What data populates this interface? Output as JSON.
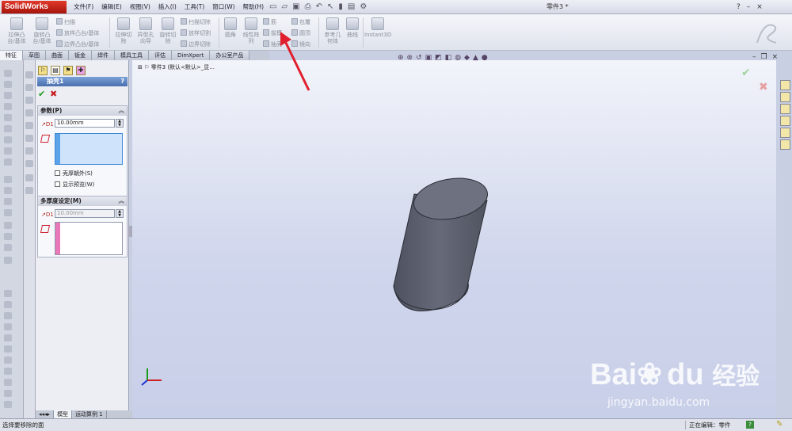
{
  "app": {
    "logo_text": "SolidWorks",
    "doc_title": "零件3 *"
  },
  "menu": [
    "文件(F)",
    "编辑(E)",
    "视图(V)",
    "插入(I)",
    "工具(T)",
    "窗口(W)",
    "帮助(H)"
  ],
  "window_controls": {
    "help": "?",
    "minimize": "–",
    "close": "×"
  },
  "ribbon": {
    "extrude_boss": "拉伸凸\n台/基体",
    "revolve_boss": "旋转凸\n台/基体",
    "sweep": "扫描",
    "loft": "放样凸台/基体",
    "boundary": "边界凸台/基体",
    "extrude_cut": "拉伸切\n除",
    "hole_wizard": "异型孔\n向导",
    "revolve_cut": "旋转切\n除",
    "sweep_cut": "扫描切除",
    "loft_cut": "放样切割",
    "boundary_cut": "边界切除",
    "fillet": "圆角",
    "linear_pattern": "线性阵\n列",
    "rib": "筋",
    "draft": "拔模",
    "shell": "抽壳",
    "wrap": "包覆",
    "dome": "圆顶",
    "mirror": "镜向",
    "ref_geometry": "参考几\n何体",
    "curves": "曲线",
    "instant3d": "Instant3D"
  },
  "tabs": [
    "特征",
    "草图",
    "曲面",
    "钣金",
    "焊件",
    "模具工具",
    "评估",
    "DimXpert",
    "办公室产品"
  ],
  "tree": {
    "part": "零件3",
    "config": "(默认<默认>_显..."
  },
  "property_manager": {
    "title": "抽壳1",
    "help": "?",
    "params_title": "参数(P)",
    "thickness_label": "D1",
    "thickness_value": "10.00mm",
    "shell_outward": "壳厚朝外(S)",
    "show_preview": "显示预览(W)",
    "multi_title": "多厚度设定(M)",
    "multi_value": "10.00mm",
    "chevron": "︽"
  },
  "bottom_tabs": [
    "模型",
    "运动算例 1"
  ],
  "status": {
    "message": "选择要移除的面",
    "editing": "正在编辑：零件",
    "help_icon": "?"
  },
  "watermark": {
    "brand": "Bai",
    "brand2": "du",
    "cn": "经验",
    "url": "jingyan.baidu.com"
  },
  "colors": {
    "accent_red": "#e0202e",
    "pm_header": "#5a7fbe",
    "viewport_bg": "#cdd4ec",
    "cylinder": "#5d6170"
  }
}
